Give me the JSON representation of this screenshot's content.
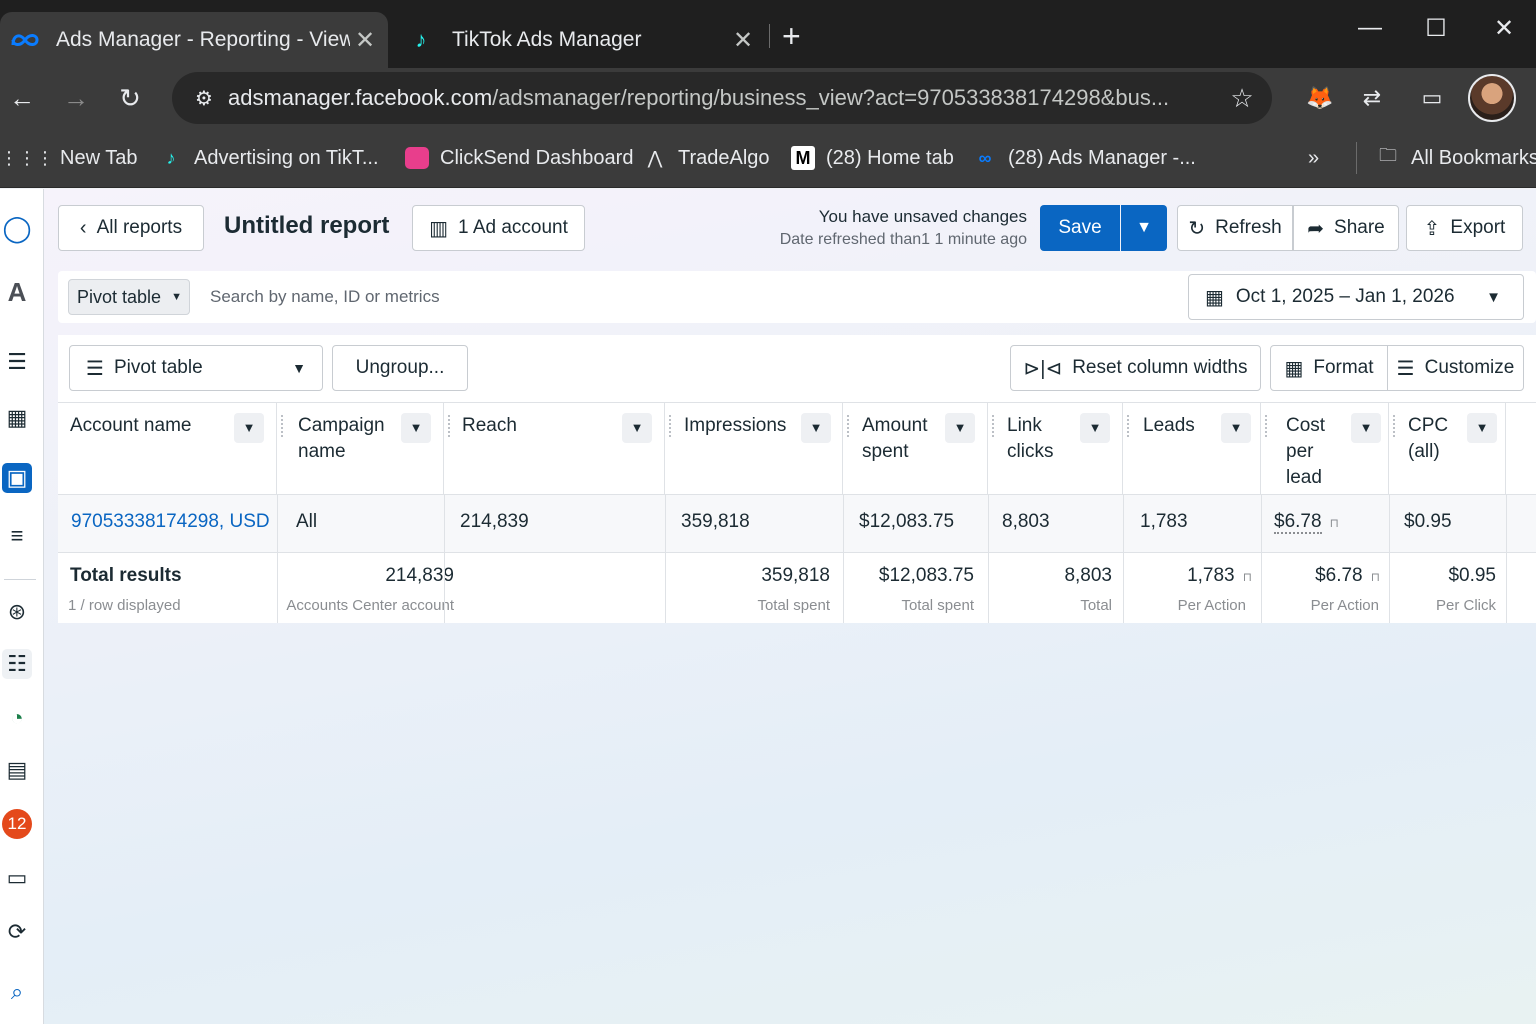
{
  "browser": {
    "tabs": [
      {
        "title": "Ads Manager - Reporting - View",
        "active": true
      },
      {
        "title": "TikTok Ads Manager",
        "active": false
      }
    ],
    "url_host": "adsmanager.facebook.com",
    "url_path": "/adsmanager/reporting/business_view?act=970533838174298&bus...",
    "bookmarks": [
      {
        "label": "New Tab",
        "icon": "grid-apps-icon"
      },
      {
        "label": "Advertising on TikT...",
        "icon": "tiktok-icon"
      },
      {
        "label": "ClickSend Dashboard",
        "icon": "clicksend-icon"
      },
      {
        "label": "TradeAlgo",
        "icon": "tradealgo-icon"
      },
      {
        "label": "(28) Home tab",
        "icon": "m-icon"
      },
      {
        "label": "(28) Ads Manager -...",
        "icon": "meta-icon"
      }
    ],
    "all_bookmarks_label": "All Bookmarks"
  },
  "header": {
    "back_label": "All reports",
    "report_title": "Untitled report",
    "ad_account_label": "1 Ad account",
    "unsaved_text": "You have unsaved changes",
    "refreshed_text": "Date refreshed than1 1 minute ago",
    "save_label": "Save",
    "refresh_label": "Refresh",
    "share_label": "Share",
    "export_label": "Export"
  },
  "filterbar": {
    "view_select": "Pivot table",
    "search_placeholder": "Search by name, ID or metrics",
    "date_range": "Oct 1, 2025 – Jan 1, 2026"
  },
  "grid_toolbar": {
    "pivot_label": "Pivot table",
    "ungroup_label": "Ungroup...",
    "reset_widths_label": "Reset column widths",
    "format_label": "Format",
    "customize_label": "Customize"
  },
  "table": {
    "columns": [
      {
        "line1": "Account name",
        "line2": "",
        "line3": ""
      },
      {
        "line1": "Campaign",
        "line2": "name",
        "line3": ""
      },
      {
        "line1": "Reach",
        "line2": "",
        "line3": ""
      },
      {
        "line1": "Impressions",
        "line2": "",
        "line3": ""
      },
      {
        "line1": "Amount",
        "line2": "spent",
        "line3": ""
      },
      {
        "line1": "Link",
        "line2": "clicks",
        "line3": ""
      },
      {
        "line1": "Leads",
        "line2": "",
        "line3": ""
      },
      {
        "line1": "Cost",
        "line2": "per",
        "line3": "lead"
      },
      {
        "line1": "CPC",
        "line2": "(all)",
        "line3": ""
      }
    ],
    "row": {
      "account_name": "97053338174298, USD",
      "campaign_name": "All",
      "reach": "214,839",
      "impressions": "359,818",
      "amount_spent": "$12,083.75",
      "link_clicks": "8,803",
      "leads": "1,783",
      "cost_per_lead": "$6.78",
      "cpc": "$0.95"
    },
    "totals": {
      "label": "Total results",
      "rows_displayed": "1 / row displayed",
      "reach": "214,839",
      "reach_sub": "Accounts Center account",
      "impressions": "359,818",
      "impressions_sub": "Total spent",
      "amount_spent": "$12,083.75",
      "amount_spent_sub": "Total spent",
      "link_clicks": "8,803",
      "link_clicks_sub": "Total",
      "leads": "1,783",
      "leads_sub": "Per Action",
      "cost_per_lead": "$6.78",
      "cost_per_lead_sub": "Per Action",
      "cpc": "$0.95",
      "cpc_sub": "Per Click"
    }
  },
  "rail": {
    "notification_count": "12"
  }
}
